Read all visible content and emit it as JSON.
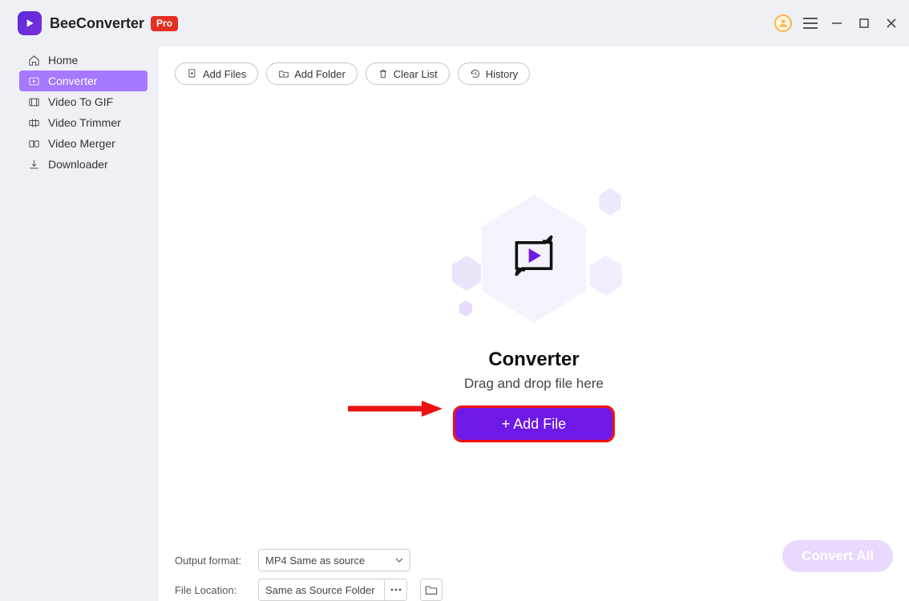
{
  "app": {
    "title": "BeeConverter",
    "badge": "Pro"
  },
  "sidebar": {
    "items": [
      {
        "label": "Home"
      },
      {
        "label": "Converter"
      },
      {
        "label": "Video To GIF"
      },
      {
        "label": "Video Trimmer"
      },
      {
        "label": "Video Merger"
      },
      {
        "label": "Downloader"
      }
    ]
  },
  "toolbar": {
    "add_files": "Add Files",
    "add_folder": "Add Folder",
    "clear_list": "Clear List",
    "history": "History"
  },
  "dropzone": {
    "title": "Converter",
    "subtitle": "Drag and drop file here",
    "add_file_label": "+ Add File"
  },
  "footer": {
    "output_label": "Output format:",
    "output_value": "MP4 Same as source",
    "location_label": "File Location:",
    "location_value": "Same as Source Folder",
    "convert_all": "Convert All"
  }
}
